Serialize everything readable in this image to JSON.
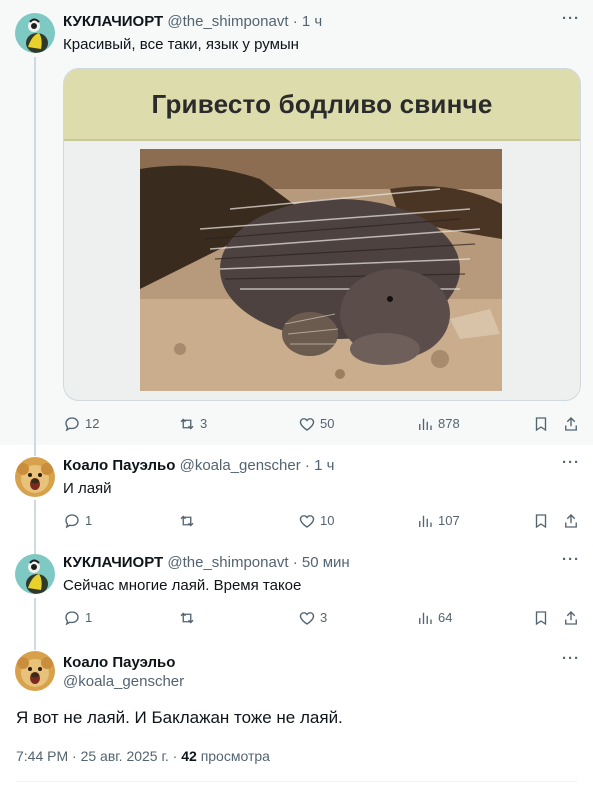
{
  "tweets": [
    {
      "name": "КУКЛАЧИОРТ",
      "handle": "@the_shimponavt",
      "separator": "·",
      "time": "1 ч",
      "text": "Красивый, все таки, язык у румын",
      "card_title": "Гривесто бодливо свинче",
      "replies": "12",
      "reposts": "3",
      "likes": "50",
      "views": "878"
    },
    {
      "name": "Коало Пауэльо",
      "handle": "@koala_genscher",
      "separator": "·",
      "time": "1 ч",
      "text": "И лаяй",
      "replies": "1",
      "reposts": "",
      "likes": "10",
      "views": "107"
    },
    {
      "name": "КУКЛАЧИОРТ",
      "handle": "@the_shimponavt",
      "separator": "·",
      "time": "50 мин",
      "text": "Сейчас многие лаяй. Время такое",
      "replies": "1",
      "reposts": "",
      "likes": "3",
      "views": "64"
    }
  ],
  "main_tweet": {
    "name": "Коало Пауэльо",
    "handle": "@koala_genscher",
    "text": "Я вот не лаяй. И Баклажан тоже не лаяй.",
    "timestamp": "7:44 PM · 25 авг. 2025 г. ·",
    "views_count": "42",
    "views_label": "просмотра"
  },
  "icons": {
    "more": "more-dots-icon",
    "reply": "reply-bubble-icon",
    "repost": "repost-arrows-icon",
    "like": "heart-icon",
    "views": "bar-chart-icon",
    "bookmark": "bookmark-icon",
    "share": "share-upload-icon"
  },
  "colors": {
    "secondary_text": "#536471",
    "thread_line": "#cfd9de",
    "banner": "#dcdcad"
  }
}
